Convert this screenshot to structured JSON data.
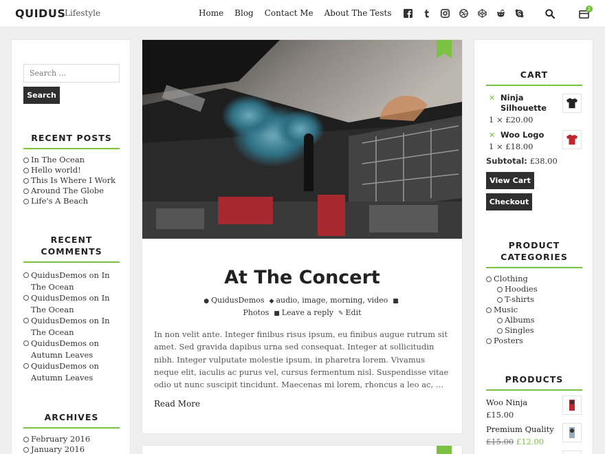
{
  "header": {
    "brand": "QUIDUS",
    "tagline": "Lifestyle",
    "nav": [
      "Home",
      "Blog",
      "Contact Me",
      "About The Tests"
    ],
    "social_icons": [
      "facebook-icon",
      "tumblr-icon",
      "instagram-icon",
      "dribbble-icon",
      "codepen-icon",
      "reddit-icon",
      "skype-icon"
    ],
    "cart_count": "2"
  },
  "left": {
    "search_placeholder": "Search ...",
    "search_button": "Search",
    "recent_posts_title": "RECENT POSTS",
    "recent_posts": [
      "In The Ocean",
      "Hello world!",
      "This Is Where I Work",
      "Around The Globe",
      "Life's A Beach"
    ],
    "recent_comments_title_1": "RECENT",
    "recent_comments_title_2": "COMMENTS",
    "recent_comments": [
      {
        "l1": "QuidusDemos on In",
        "l2": "The Ocean"
      },
      {
        "l1": "QuidusDemos on In",
        "l2": "The Ocean"
      },
      {
        "l1": "QuidusDemos on In",
        "l2": "The Ocean"
      },
      {
        "l1": "QuidusDemos on",
        "l2": "Autumn Leaves"
      },
      {
        "l1": "QuidusDemos on",
        "l2": "Autumn Leaves"
      }
    ],
    "archives_title": "ARCHIVES",
    "archives": [
      "February 2016",
      "January 2016"
    ]
  },
  "post": {
    "title": "At The Concert",
    "author": "QuidusDemos",
    "tags": "audio, image, morning, video",
    "category": "Photos",
    "reply": "Leave a reply",
    "edit": "Edit",
    "excerpt": "In non velit ante. Integer finibus risus ipsum, eu finibus augue rutrum sit amet. Sed gravida dapibus urna sed consequat. Integer at sollicitudin nibh. Integer vulputate molestie ipsum, in pharetra lorem. Vivamus neque elit, iaculis ac purus vel, cursus fermentum nisl. Suspendisse vitae odio ut nunc suscipit tincidunt. Maecenas mi lorem, rhoncus a leo ac, …",
    "read_more": "Read More"
  },
  "right": {
    "cart_title": "CART",
    "cart_items": [
      {
        "name1": "Ninja",
        "name2": "Silhouette",
        "qty": "1 × £20.00"
      },
      {
        "name1": "Woo Logo",
        "name2": "",
        "qty": "1 × £18.00"
      }
    ],
    "subtotal_label": "Subtotal:",
    "subtotal_value": "£38.00",
    "view_cart": "View Cart",
    "checkout": "Checkout",
    "categories_title_1": "PRODUCT",
    "categories_title_2": "CATEGORIES",
    "categories": [
      "Clothing",
      "Hoodies",
      "T-shirts",
      "Music",
      "Albums",
      "Singles",
      "Posters"
    ],
    "products_title": "PRODUCTS",
    "products": [
      {
        "name": "Woo Ninja",
        "price": "£15.00",
        "old": "",
        "new": ""
      },
      {
        "name": "Premium Quality",
        "price": "",
        "old": "£15.00",
        "new": "£12.00"
      }
    ]
  },
  "colors": {
    "accent": "#7cc242",
    "dark": "#2f2f2f"
  }
}
